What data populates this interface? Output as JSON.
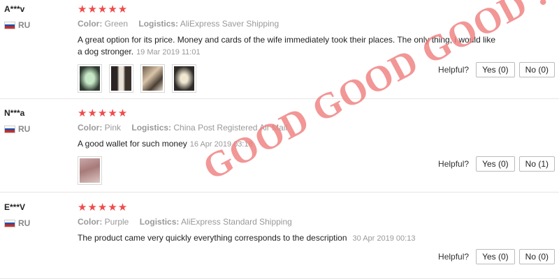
{
  "reviews": [
    {
      "user": "A***v",
      "country": "RU",
      "stars": "★★★★★",
      "color_label": "Color:",
      "color": "Green",
      "logistics_label": "Logistics:",
      "logistics": "AliExpress Saver Shipping",
      "text": "A great option for its price. Money and cards of the wife immediately took their places. The only thing, i would like a dog stronger.",
      "date": "19 Mar 2019 11:01",
      "helpful_label": "Helpful?",
      "yes": "Yes (0)",
      "no": "No (0)"
    },
    {
      "user": "N***a",
      "country": "RU",
      "stars": "★★★★★",
      "color_label": "Color:",
      "color": "Pink",
      "logistics_label": "Logistics:",
      "logistics": "China Post Registered Air Mail",
      "text": "A good wallet for such money",
      "date": "16 Apr 2019 03:18",
      "helpful_label": "Helpful?",
      "yes": "Yes (0)",
      "no": "No (1)"
    },
    {
      "user": "E***V",
      "country": "RU",
      "stars": "★★★★★",
      "color_label": "Color:",
      "color": "Purple",
      "logistics_label": "Logistics:",
      "logistics": "AliExpress Standard Shipping",
      "text": "The product came very quickly everything corresponds to the description",
      "date": "30 Apr 2019 00:13",
      "helpful_label": "Helpful?",
      "yes": "Yes (0)",
      "no": "No (0)"
    }
  ],
  "overlay_text": "GOOD GOOD GOOD !",
  "colors": {
    "star": "#f04b4b",
    "overlay": "#f08080",
    "muted": "#999999"
  }
}
